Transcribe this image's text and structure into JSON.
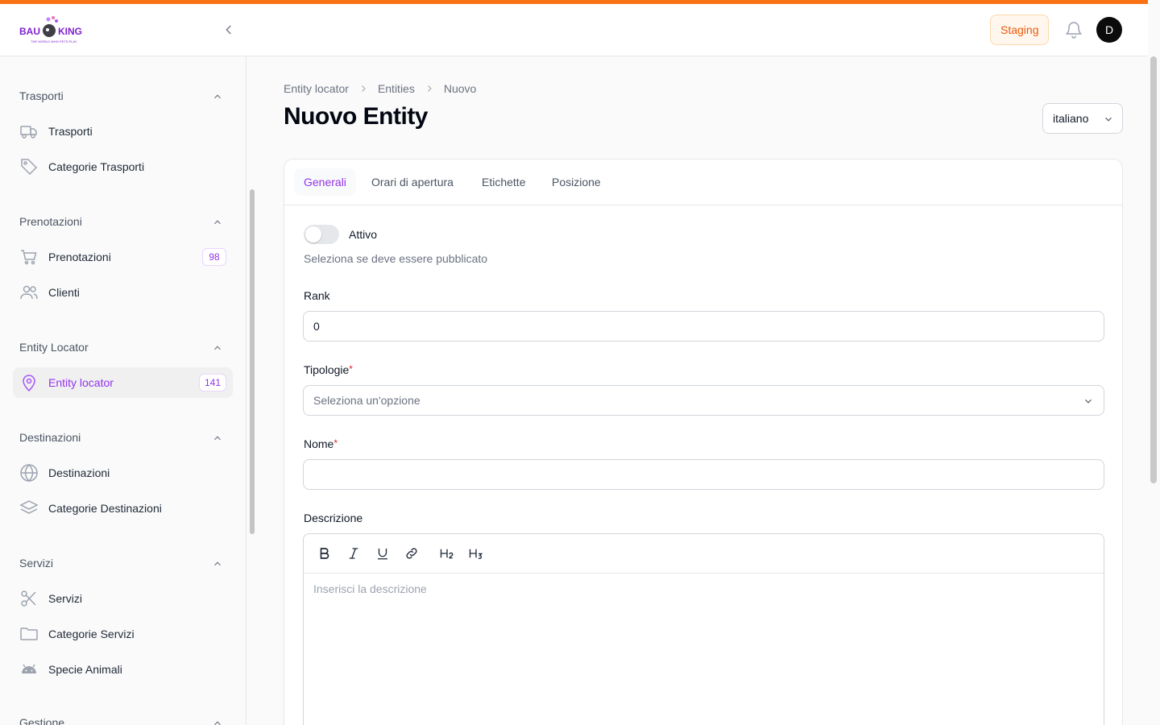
{
  "header": {
    "logo_text": "BAU KING",
    "logo_tagline": "THE WORLD WHO PETS PLAY",
    "staging_label": "Staging",
    "avatar_initial": "D"
  },
  "sidebar": {
    "groups": [
      {
        "title": "Trasporti",
        "items": [
          {
            "label": "Trasporti",
            "icon": "truck-icon"
          },
          {
            "label": "Categorie Trasporti",
            "icon": "tag-icon"
          }
        ]
      },
      {
        "title": "Prenotazioni",
        "items": [
          {
            "label": "Prenotazioni",
            "icon": "cart-icon",
            "badge": "98"
          },
          {
            "label": "Clienti",
            "icon": "users-icon"
          }
        ]
      },
      {
        "title": "Entity Locator",
        "items": [
          {
            "label": "Entity locator",
            "icon": "map-pin-icon",
            "badge": "141",
            "active": true
          }
        ]
      },
      {
        "title": "Destinazioni",
        "items": [
          {
            "label": "Destinazioni",
            "icon": "globe-icon"
          },
          {
            "label": "Categorie Destinazioni",
            "icon": "layers-icon"
          }
        ]
      },
      {
        "title": "Servizi",
        "items": [
          {
            "label": "Servizi",
            "icon": "scissors-icon"
          },
          {
            "label": "Categorie Servizi",
            "icon": "folder-icon"
          },
          {
            "label": "Specie Animali",
            "icon": "android-icon"
          }
        ]
      },
      {
        "title": "Gestione",
        "items": []
      }
    ]
  },
  "breadcrumb": [
    "Entity locator",
    "Entities",
    "Nuovo"
  ],
  "page": {
    "title": "Nuovo Entity",
    "language": "italiano"
  },
  "tabs": [
    "Generali",
    "Orari di apertura",
    "Etichette",
    "Posizione"
  ],
  "form": {
    "active_label": "Attivo",
    "active_help": "Seleziona se deve essere pubblicato",
    "rank_label": "Rank",
    "rank_value": "0",
    "tipologie_label": "Tipologie",
    "tipologie_placeholder": "Seleziona un'opzione",
    "nome_label": "Nome",
    "nome_value": "",
    "descrizione_label": "Descrizione",
    "descrizione_placeholder": "Inserisci la descrizione",
    "required_mark": "*"
  },
  "colors": {
    "accent": "#9333ea",
    "brand_stripe": "#f97316",
    "staging_text": "#ea580c"
  }
}
